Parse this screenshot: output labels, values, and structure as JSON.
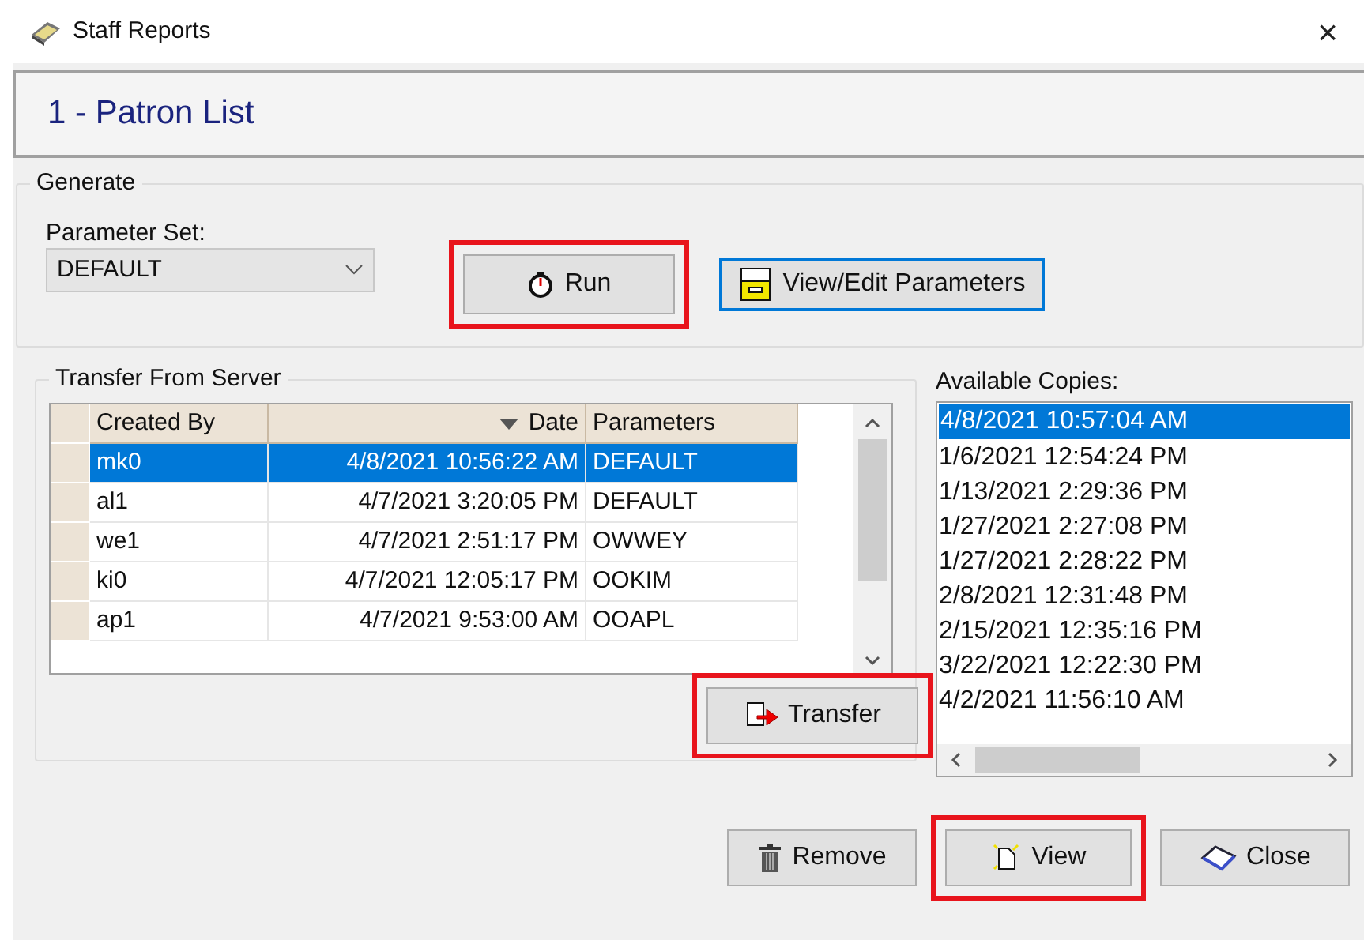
{
  "window": {
    "title": "Staff Reports",
    "close": "×"
  },
  "report_title": "1 - Patron List",
  "generate": {
    "label": "Generate",
    "parameter_set_label": "Parameter Set:",
    "parameter_set": "DEFAULT",
    "buttons": [
      {
        "kind": "run",
        "label": "Run",
        "highlighted": true,
        "focused": false
      },
      {
        "kind": "params",
        "label": "View/Edit Parameters",
        "highlighted": false,
        "focused": true
      }
    ]
  },
  "transfer": {
    "label": "Transfer From Server",
    "columns": [
      {
        "label": "Created By",
        "sorted": false
      },
      {
        "label": "Date",
        "sorted": true
      },
      {
        "label": "Parameters",
        "sorted": false
      }
    ],
    "rows": [
      {
        "created_by": "mk0",
        "date": "4/8/2021 10:56:22 AM",
        "parameters": "DEFAULT",
        "selected": true
      },
      {
        "created_by": "al1",
        "date": "4/7/2021 3:20:05 PM",
        "parameters": "DEFAULT",
        "selected": false
      },
      {
        "created_by": "we1",
        "date": "4/7/2021 2:51:17 PM",
        "parameters": "OWWEY",
        "selected": false
      },
      {
        "created_by": "ki0",
        "date": "4/7/2021 12:05:17 PM",
        "parameters": "OOKIM",
        "selected": false
      },
      {
        "created_by": "ap1",
        "date": "4/7/2021 9:53:00 AM",
        "parameters": "OOAPL",
        "selected": false
      }
    ],
    "button": {
      "kind": "transfer",
      "label": "Transfer",
      "highlighted": true
    }
  },
  "copies": {
    "label": "Available Copies:",
    "items": [
      {
        "label": "4/8/2021 10:57:04 AM",
        "selected": true
      },
      {
        "label": "1/6/2021 12:54:24 PM",
        "selected": false
      },
      {
        "label": "1/13/2021 2:29:36 PM",
        "selected": false
      },
      {
        "label": "1/27/2021 2:27:08 PM",
        "selected": false
      },
      {
        "label": "1/27/2021 2:28:22 PM",
        "selected": false
      },
      {
        "label": "2/8/2021 12:31:48 PM",
        "selected": false
      },
      {
        "label": "2/15/2021 12:35:16 PM",
        "selected": false
      },
      {
        "label": "3/22/2021 12:22:30 PM",
        "selected": false
      },
      {
        "label": "4/2/2021 11:56:10 AM",
        "selected": false
      }
    ]
  },
  "footer_buttons": [
    {
      "kind": "remove",
      "label": "Remove",
      "highlighted": false
    },
    {
      "kind": "view",
      "label": "View",
      "highlighted": true
    },
    {
      "kind": "close",
      "label": "Close",
      "highlighted": false
    }
  ]
}
